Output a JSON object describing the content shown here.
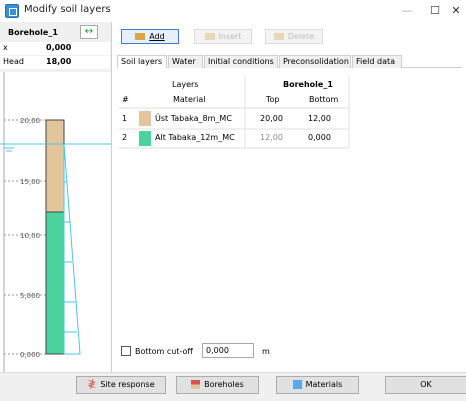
{
  "window": {
    "title": "Modify soil layers",
    "minimize": "—",
    "maximize": "☐",
    "close": "✕"
  },
  "borehole_panel": {
    "name": "Borehole_1",
    "x_label": "x",
    "x_value": "0,000",
    "head_label": "Head",
    "head_value": "18,00",
    "axis_ticks": [
      "20,00",
      "15,00",
      "10,00",
      "5,000",
      "0,000"
    ]
  },
  "toolbar": {
    "add_label": "Add",
    "insert_label": "Insert",
    "delete_label": "Delete"
  },
  "tabs": [
    "Soil layers",
    "Water",
    "Initial conditions",
    "Preconsolidation",
    "Field data"
  ],
  "table": {
    "group_headers": {
      "layers": "Layers",
      "borehole": "Borehole_1"
    },
    "columns": {
      "num": "#",
      "material": "Material",
      "top": "Top",
      "bottom": "Bottom"
    },
    "rows": [
      {
        "num": "1",
        "material": "Üst Tabaka_8m_MC",
        "top": "20,00",
        "bottom": "12,00",
        "color": "#e3c59b"
      },
      {
        "num": "2",
        "material": "Alt Tabaka_12m_MC",
        "top": "12,00",
        "bottom": "0,000",
        "color": "#49d49e"
      }
    ]
  },
  "cutoff": {
    "label": "Bottom cut-off",
    "value": "0,000",
    "unit": "m"
  },
  "bottom_buttons": {
    "site_response": "Site response",
    "boreholes": "Boreholes",
    "materials": "Materials",
    "ok": "OK"
  },
  "colors": {
    "layer1": "#e3c59b",
    "layer2": "#49d49e",
    "water": "#4fc3e8",
    "accent": "#3b7dd8"
  }
}
